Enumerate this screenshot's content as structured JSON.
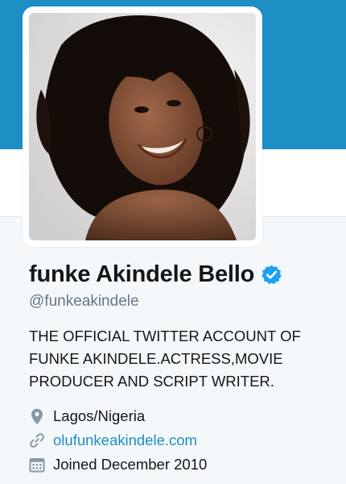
{
  "colors": {
    "banner": "#1b8fc4",
    "link": "#1b8fc4",
    "verified": "#1da1f2",
    "muted": "#657786",
    "text": "#14171a"
  },
  "profile": {
    "display_name": "funke Akindele Bello",
    "handle": "@funkeakindele",
    "verified_badge_icon": "verified-badge-icon",
    "bio": "THE OFFICIAL TWITTER ACCOUNT OF FUNKE AKINDELE.ACTRESS,MOVIE PRODUCER AND SCRIPT WRITER.",
    "location": "Lagos/Nigeria",
    "website": "olufunkeakindele.com",
    "joined": "Joined December 2010"
  },
  "icons": {
    "location": "map-pin-icon",
    "website": "link-icon",
    "joined": "calendar-icon"
  }
}
